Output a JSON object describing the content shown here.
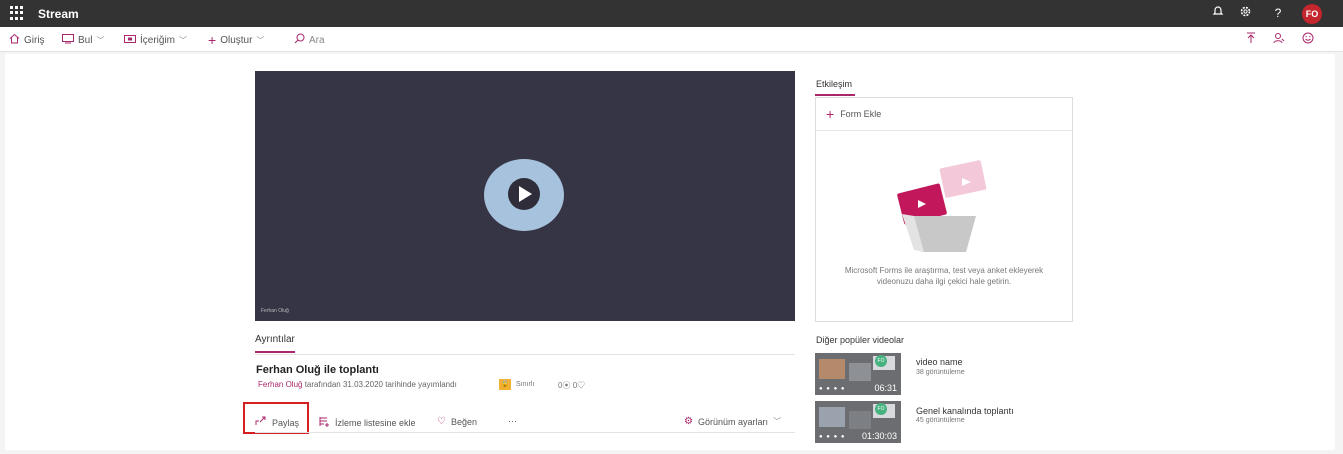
{
  "app": {
    "title": "Stream",
    "user_initials": "FO",
    "accent": "#a8286b"
  },
  "top_icons": [
    "bell-icon",
    "gear-icon",
    "help-icon"
  ],
  "nav": {
    "home": "Giriş",
    "find": "Bul",
    "content": "İçeriğim",
    "create": "Oluştur",
    "search_placeholder": "Ara"
  },
  "video": {
    "caption": "Ferhan Oluğ",
    "title": "Ferhan Oluğ ile toplantı",
    "owner": "Ferhan Oluğ",
    "published_text": " tarafından 31.03.2020 tarihinde yayımlandı",
    "visibility": "Sınırlı",
    "views": "0",
    "likes": "0"
  },
  "details_tab": "Ayrıntılar",
  "actions": {
    "share": "Paylaş",
    "add_watchlist": "İzleme listesine ekle",
    "like": "Beğen",
    "more": "···",
    "view_settings": "Görünüm ayarları"
  },
  "interaction": {
    "tab": "Etkileşim",
    "add_form": "Form Ekle",
    "description": "Microsoft Forms ile araştırma, test veya anket ekleyerek videonuzu daha ilgi çekici hale getirin."
  },
  "popular": {
    "title": "Diğer popüler videolar",
    "items": [
      {
        "name": "video name",
        "views": "38 görüntüleme",
        "duration": "06:31",
        "avatar": "FO"
      },
      {
        "name": "Genel kanalında toplantı",
        "views": "45 görüntüleme",
        "duration": "01:30:03",
        "avatar": "FO"
      }
    ]
  }
}
